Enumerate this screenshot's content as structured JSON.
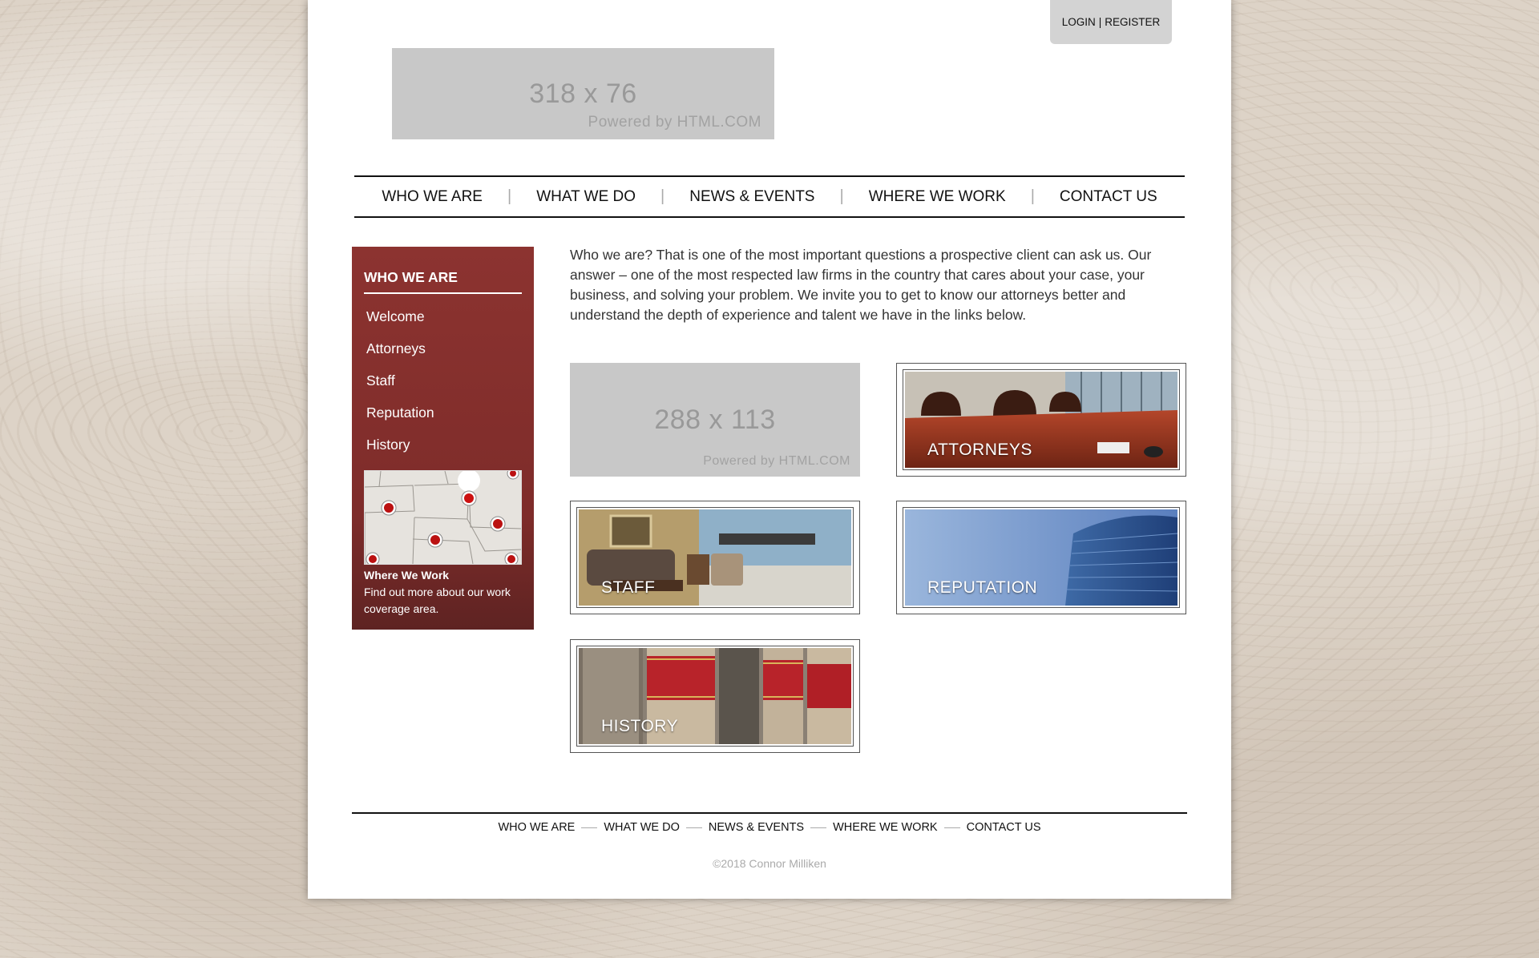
{
  "header": {
    "login_label": "LOGIN",
    "separator": "|",
    "register_label": "REGISTER",
    "logo": {
      "dimensions": "318 x 76",
      "powered": "Powered by HTML.COM"
    }
  },
  "nav": {
    "items": [
      "WHO WE ARE",
      "WHAT WE DO",
      "NEWS & EVENTS",
      "WHERE WE WORK",
      "CONTACT US"
    ],
    "separator": "|"
  },
  "sidebar": {
    "title": "WHO WE ARE",
    "links": [
      "Welcome",
      "Attorneys",
      "Staff",
      "Reputation",
      "History"
    ],
    "map_heading": "Where We Work",
    "map_text": "Find out more about our work coverage area."
  },
  "main": {
    "intro": "Who we are? That is one of the most important questions a prospective client can ask us. Our answer – one of the most respected law firms in the country that cares about your case, your business, and solving your problem. We invite you to get to know our attorneys better and understand the depth of experience and talent we have in the links below.",
    "welcome_placeholder": {
      "dimensions": "288 x 113",
      "powered": "Powered by HTML.COM"
    },
    "tiles": {
      "attorneys": "ATTORNEYS",
      "staff": "STAFF",
      "reputation": "REPUTATION",
      "history": "HISTORY"
    }
  },
  "footer": {
    "nav": [
      "WHO WE ARE",
      "WHAT WE DO",
      "NEWS & EVENTS",
      "WHERE WE WORK",
      "CONTACT US"
    ],
    "copyright": "©2018 Connor Milliken"
  },
  "colors": {
    "sidebar": "#8c3330",
    "background": "#ddd3c7",
    "placeholder": "#c8c8c8"
  }
}
